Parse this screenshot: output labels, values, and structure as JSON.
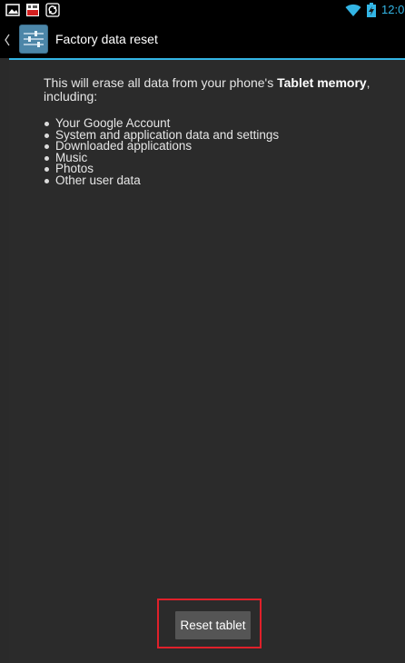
{
  "status_bar": {
    "time": "12:0",
    "accent_color": "#33b5e5",
    "icons": [
      "gallery-icon",
      "app-notification-icon",
      "sync-icon",
      "wifi-icon",
      "battery-charging-icon"
    ]
  },
  "action_bar": {
    "title": "Factory data reset",
    "icon": "settings-icon"
  },
  "content": {
    "intro_prefix": "This will erase all data from your phone's ",
    "intro_bold": "Tablet memory",
    "intro_suffix": ", including:",
    "items": [
      "Your Google Account",
      "System and application data and settings",
      "Downloaded applications",
      "Music",
      "Photos",
      "Other user data"
    ]
  },
  "reset_button": {
    "label": "Reset tablet",
    "highlight_color": "#e0202a"
  }
}
